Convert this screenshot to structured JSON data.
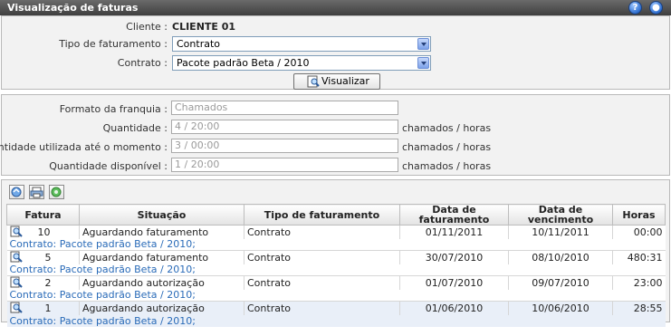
{
  "window": {
    "title": "Visualização de faturas"
  },
  "form": {
    "cliente_label": "Cliente :",
    "cliente_value": "CLIENTE 01",
    "tipo_label": "Tipo de faturamento :",
    "tipo_value": "Contrato",
    "contrato_label": "Contrato :",
    "contrato_value": "Pacote padrão Beta / 2010",
    "visualizar_label": "Visualizar"
  },
  "franquia": {
    "formato_label": "Formato da franquia :",
    "formato_value": "Chamados",
    "quantidade_label": "Quantidade :",
    "quantidade_value": "4 / 20:00",
    "utilizada_label": "Quantidade utilizada até o momento :",
    "utilizada_value": "3 / 00:00",
    "disponivel_label": "Quantidade disponível :",
    "disponivel_value": "1 / 20:00",
    "unit": "chamados / horas"
  },
  "table": {
    "headers": [
      "Fatura",
      "Situação",
      "Tipo de faturamento",
      "Data de faturamento",
      "Data de vencimento",
      "Horas"
    ],
    "rows": [
      {
        "fatura": "10",
        "situacao": "Aguardando faturamento",
        "tipo": "Contrato",
        "data_fat": "01/11/2011",
        "data_venc": "10/11/2011",
        "horas": "00:00",
        "contrato": "Contrato: Pacote padrão Beta / 2010;"
      },
      {
        "fatura": "5",
        "situacao": "Aguardando faturamento",
        "tipo": "Contrato",
        "data_fat": "30/07/2010",
        "data_venc": "08/10/2010",
        "horas": "480:31",
        "contrato": "Contrato: Pacote padrão Beta / 2010;"
      },
      {
        "fatura": "2",
        "situacao": "Aguardando autorização",
        "tipo": "Contrato",
        "data_fat": "01/07/2010",
        "data_venc": "09/07/2010",
        "horas": "23:00",
        "contrato": "Contrato: Pacote padrão Beta / 2010;"
      },
      {
        "fatura": "1",
        "situacao": "Aguardando autorização",
        "tipo": "Contrato",
        "data_fat": "01/06/2010",
        "data_venc": "10/06/2010",
        "horas": "28:55",
        "contrato": "Contrato: Pacote padrão Beta / 2010;"
      }
    ]
  },
  "icons": {
    "help": "help-icon",
    "world": "globe-icon",
    "view": "magnifier-icon",
    "export": "export-icon",
    "print": "print-icon",
    "refresh": "refresh-icon"
  },
  "colors": {
    "titlebar": "#4a4a4a",
    "link": "#2a6bb8",
    "selected_row": "#e9eff8"
  }
}
